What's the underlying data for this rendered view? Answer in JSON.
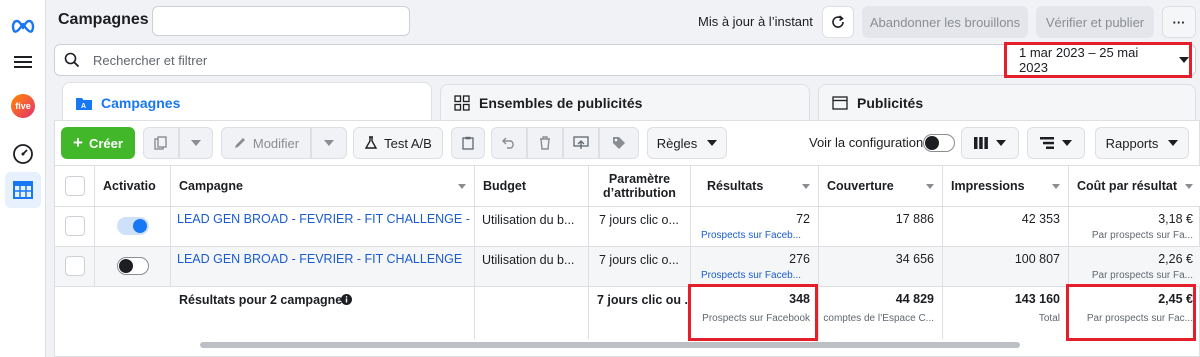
{
  "app": {
    "title": "Campagnes",
    "updated_text": "Mis à jour à l’instant",
    "discard_label": "Abandonner les brouillons",
    "publish_label": "Vérifier et publier",
    "more_label": "···"
  },
  "search": {
    "placeholder": "Rechercher et filtrer",
    "date_range": "1 mar 2023 – 25 mai 2023"
  },
  "tabs": [
    {
      "label": "Campagnes",
      "active": true
    },
    {
      "label": "Ensembles de publicités",
      "active": false
    },
    {
      "label": "Publicités",
      "active": false
    }
  ],
  "toolbar": {
    "create_label": "Créer",
    "edit_label": "Modifier",
    "abtest_label": "Test A/B",
    "rules_label": "Règles",
    "view_config_label": "Voir la configuration",
    "reports_label": "Rapports"
  },
  "columns": [
    "Activatio",
    "Campagne",
    "Budget",
    "Paramètre d’attribution",
    "Résultats",
    "Couverture",
    "Impressions",
    "Coût par résultat"
  ],
  "rows": [
    {
      "active": true,
      "campaign": "LEAD GEN BROAD - FEVRIER - FIT CHALLENGE - C...",
      "budget": "Utilisation du b...",
      "attribution": "7 jours clic o...",
      "results": "72",
      "results_sub": "Prospects sur Faceb...",
      "reach": "17 886",
      "impressions": "42 353",
      "cost": "3,18 €",
      "cost_sub": "Par prospects sur Fa..."
    },
    {
      "active": false,
      "campaign": "LEAD GEN BROAD - FEVRIER - FIT CHALLENGE",
      "budget": "Utilisation du b...",
      "attribution": "7 jours clic o...",
      "results": "276",
      "results_sub": "Prospects sur Faceb...",
      "reach": "34 656",
      "impressions": "100 807",
      "cost": "2,26 €",
      "cost_sub": "Par prospects sur Fa..."
    }
  ],
  "totals": {
    "label": "Résultats pour 2 campagnes",
    "attribution": "7 jours clic ou ...",
    "results": "348",
    "results_sub": "Prospects sur Facebook",
    "reach": "44 829",
    "reach_sub": "comptes de l’Espace C...",
    "impressions": "143 160",
    "impressions_sub": "Total",
    "cost": "2,45 €",
    "cost_sub": "Par prospects sur Fac..."
  },
  "colors": {
    "accent": "#1877f2",
    "create_green": "#42b72a",
    "highlight_red": "#e41e2b",
    "link": "#1a5ccf"
  },
  "icons": [
    "meta-logo-icon",
    "menu-icon",
    "five-logo",
    "gauge-icon",
    "table-icon",
    "refresh-icon",
    "search-icon",
    "caret-down-icon",
    "duplicate-icon",
    "pencil-icon",
    "flask-icon",
    "clipboard-icon",
    "undo-icon",
    "trash-icon",
    "export-icon",
    "tag-icon",
    "columns-icon",
    "breakdown-icon",
    "info-icon"
  ]
}
